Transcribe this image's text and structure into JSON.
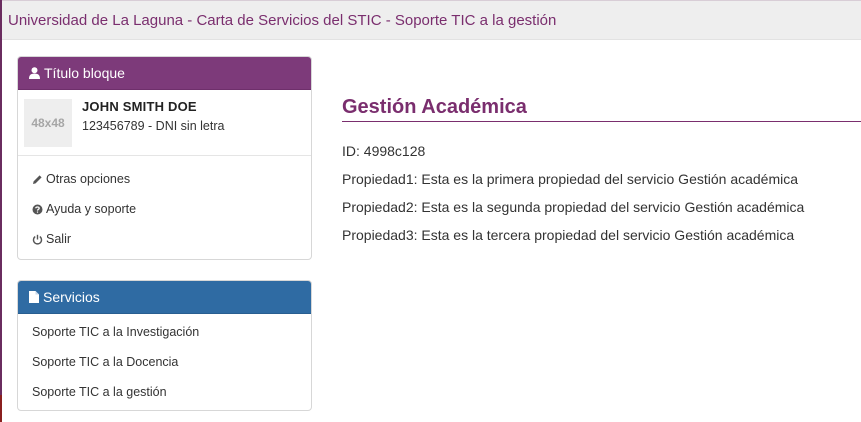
{
  "header": {
    "title": "Universidad de La Laguna - Carta de Servicios del STIC - Soporte TIC a la gestión"
  },
  "user_panel": {
    "heading": "Título bloque",
    "heading_icon": "user-icon",
    "avatar_text": "48x48",
    "user_name": "JOHN SMITH DOE",
    "user_id": "123456789 - DNI sin letra",
    "menu": [
      {
        "label": "Otras opciones",
        "icon": "pencil-icon"
      },
      {
        "label": "Ayuda y soporte",
        "icon": "question-circle-icon"
      },
      {
        "label": "Salir",
        "icon": "power-icon"
      }
    ]
  },
  "services_panel": {
    "heading": "Servicios",
    "heading_icon": "file-icon",
    "items": [
      {
        "label": "Soporte TIC a la Investigación"
      },
      {
        "label": "Soporte TIC a la Docencia"
      },
      {
        "label": "Soporte TIC a la gestión"
      }
    ]
  },
  "content": {
    "title": "Gestión Académica",
    "id_line": "ID: 4998c128",
    "properties": [
      "Propiedad1: Esta es la primera propiedad del servicio Gestión académica",
      "Propiedad2: Esta es la segunda propiedad del servicio Gestión académica",
      "Propiedad3: Esta es la tercera propiedad del servicio Gestión académica"
    ]
  },
  "colors": {
    "brand_purple": "#7d3a7a",
    "services_blue": "#2f6ba3",
    "title_purple": "#7a2e6e",
    "topbar_bg": "#eeeeee"
  }
}
